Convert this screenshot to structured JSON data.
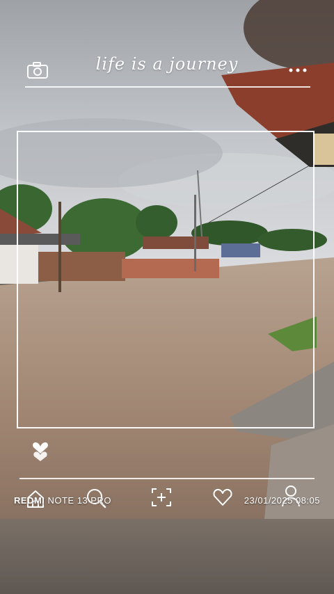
{
  "photo": {
    "sky_color": "#b9bcc0",
    "ground_color": "#a8917c"
  },
  "overlay": {
    "title_script": "life is a journey",
    "icons": {
      "camera": "camera-icon",
      "more": "more-dots-icon",
      "heart_filled": "heart-filled-icon",
      "home": "home-icon",
      "search": "search-icon",
      "add": "add-frame-icon",
      "heart": "heart-outline-icon",
      "user": "user-icon"
    }
  },
  "watermark": {
    "brand": "REDMI",
    "model": " NOTE 13 PRO",
    "datetime": "23/01/2025  08:05"
  }
}
